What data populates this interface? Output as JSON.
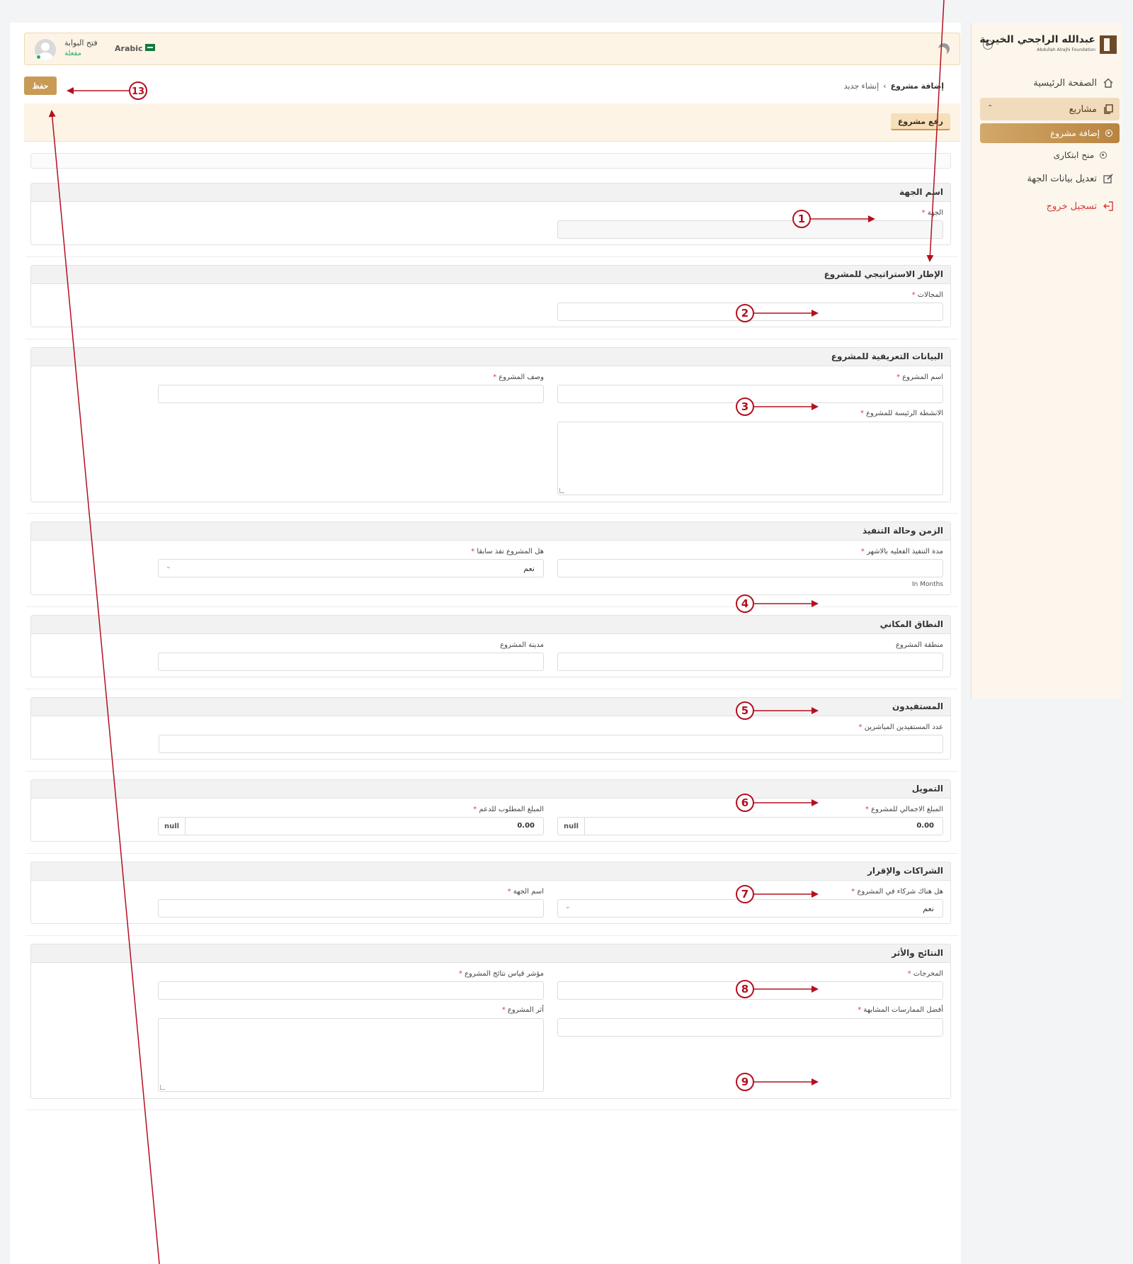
{
  "sidebar": {
    "logo_ar": "عبدالله الراجحي الخيرية",
    "logo_en": "Abdullah Alrajhi Foundation",
    "home": "الصفحة الرئيسية",
    "projects": "مشاريع",
    "add_project": "إضافة مشروع",
    "innovative_grants": "منح ابتكارى",
    "edit_entity": "تعديل بيانات الجهة",
    "logout": "تسجيل خروج"
  },
  "topbar": {
    "portal_title": "فتح البوابة",
    "portal_status": "مفعلة",
    "language": "Arabic"
  },
  "toolbar": {
    "save_label": "حفظ"
  },
  "breadcrumb": {
    "current": "إضافة مشروع",
    "separator": "›",
    "next": "إنشاء جديد"
  },
  "banner": {
    "tab_label": "رفع مشروع"
  },
  "sections": {
    "s1": {
      "title": "اسم الجهة",
      "entity_label": "الجهة"
    },
    "s2": {
      "title": "الإطار الاستراتيجي للمشروع",
      "fields_label": "المجالات"
    },
    "s3": {
      "title": "البيانات التعريفية للمشروع",
      "name_label": "اسم المشروع",
      "desc_label": "وصف المشروع",
      "activities_label": "الانشطة الرئيسة للمشروع"
    },
    "s4": {
      "title": "الزمن وحالة التنفيذ",
      "duration_label": "مدة التنفيذ الفعليه بالاشهر",
      "duration_hint": "In Months",
      "executed_label": "هل المشروع نفذ سابقا",
      "executed_value": "نعم"
    },
    "s5": {
      "title": "النطاق المكاني",
      "region_label": "منطقة المشروع",
      "city_label": "مدينة المشروع"
    },
    "s6": {
      "title": "المستفيدون",
      "beneficiaries_label": "عدد المستفيدين المباشرين"
    },
    "s7": {
      "title": "التمويل",
      "total_label": "المبلغ الاجمالي للمشروع",
      "total_value": "0.00",
      "total_currency": "null",
      "requested_label": "المبلغ المطلوب للدعم",
      "requested_value": "0.00",
      "requested_currency": "null"
    },
    "s8": {
      "title": "الشراكات والإقرار",
      "partners_label": "هل هناك شركاء في المشروع",
      "partners_value": "نعم",
      "partner_name_label": "اسم الجهة"
    },
    "s9": {
      "title": "النتائج والأثر",
      "outputs_label": "المخرجات",
      "indicator_label": "مؤشر قياس نتائج المشروع",
      "best_practices_label": "أفضل الممارسات المشابهة",
      "impact_label": "أثر المشروع"
    }
  },
  "annotations": [
    "1",
    "2",
    "3",
    "4",
    "5",
    "6",
    "7",
    "8",
    "9",
    "13"
  ],
  "colors": {
    "accent": "#c89a55",
    "annotation": "#b3101f",
    "required": "#d63b3b",
    "online": "#27ae60"
  }
}
